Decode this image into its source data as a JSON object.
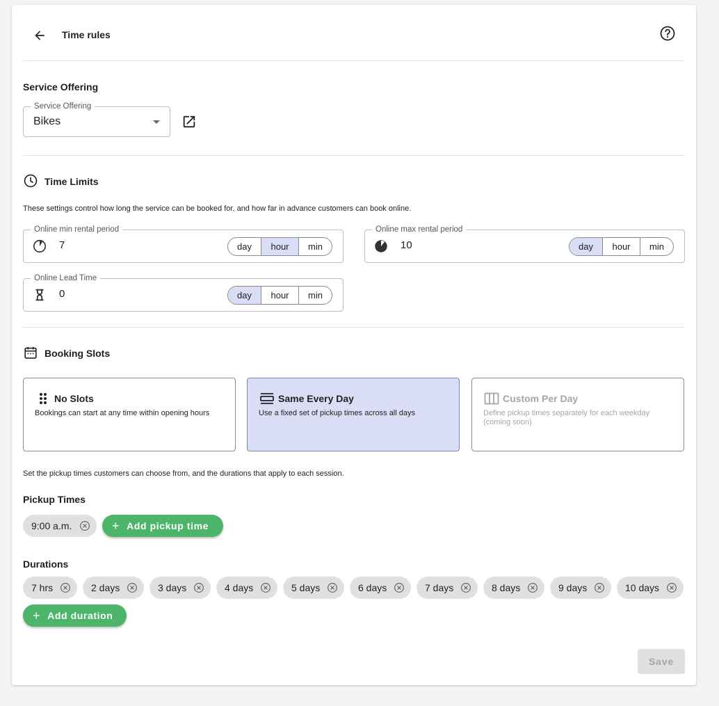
{
  "header": {
    "title": "Time rules",
    "back_icon": "arrow-left-icon",
    "help_icon": "help-circle-icon"
  },
  "service_offering": {
    "section_title": "Service Offering",
    "field_label": "Service Offering",
    "value": "Bikes",
    "open_icon": "open-in-new-icon"
  },
  "time_limits": {
    "section_title": "Time Limits",
    "icon": "clock-icon",
    "description": "These settings control how long the service can be booked for, and how far in advance customers can book online.",
    "fields": [
      {
        "label": "Online min rental period",
        "value": "7",
        "icon": "pie-quarter-icon",
        "units": [
          "day",
          "hour",
          "min"
        ],
        "selected_unit": "hour"
      },
      {
        "label": "Online max rental period",
        "value": "10",
        "icon": "pie-three-quarter-icon",
        "units": [
          "day",
          "hour",
          "min"
        ],
        "selected_unit": "day"
      },
      {
        "label": "Online Lead Time",
        "value": "0",
        "icon": "hourglass-icon",
        "units": [
          "day",
          "hour",
          "min"
        ],
        "selected_unit": "day"
      }
    ]
  },
  "booking_slots": {
    "section_title": "Booking Slots",
    "icon": "calendar-icon",
    "options": [
      {
        "title": "No Slots",
        "description": "Bookings can start at any time within opening hours",
        "icon": "drag-dots-icon",
        "selected": false,
        "disabled": false
      },
      {
        "title": "Same Every Day",
        "description": "Use a fixed set of pickup times across all days",
        "icon": "view-agenda-icon",
        "selected": true,
        "disabled": false
      },
      {
        "title": "Custom Per Day",
        "description": "Define pickup times separately for each weekday (coming soon)",
        "icon": "view-column-icon",
        "selected": false,
        "disabled": true
      }
    ],
    "instructions": "Set the pickup times customers can choose from, and the durations that apply to each session."
  },
  "pickup_times": {
    "title": "Pickup Times",
    "chips": [
      "9:00 a.m."
    ],
    "add_label": "Add pickup time"
  },
  "durations": {
    "title": "Durations",
    "chips": [
      "7 hrs",
      "2 days",
      "3 days",
      "4 days",
      "5 days",
      "6 days",
      "7 days",
      "8 days",
      "9 days",
      "10 days"
    ],
    "add_label": "Add duration"
  },
  "save_label": "Save",
  "colors": {
    "accent_green": "#4cb56a",
    "selected_bg": "#d9def6",
    "chip_bg": "#e0e0e0"
  }
}
